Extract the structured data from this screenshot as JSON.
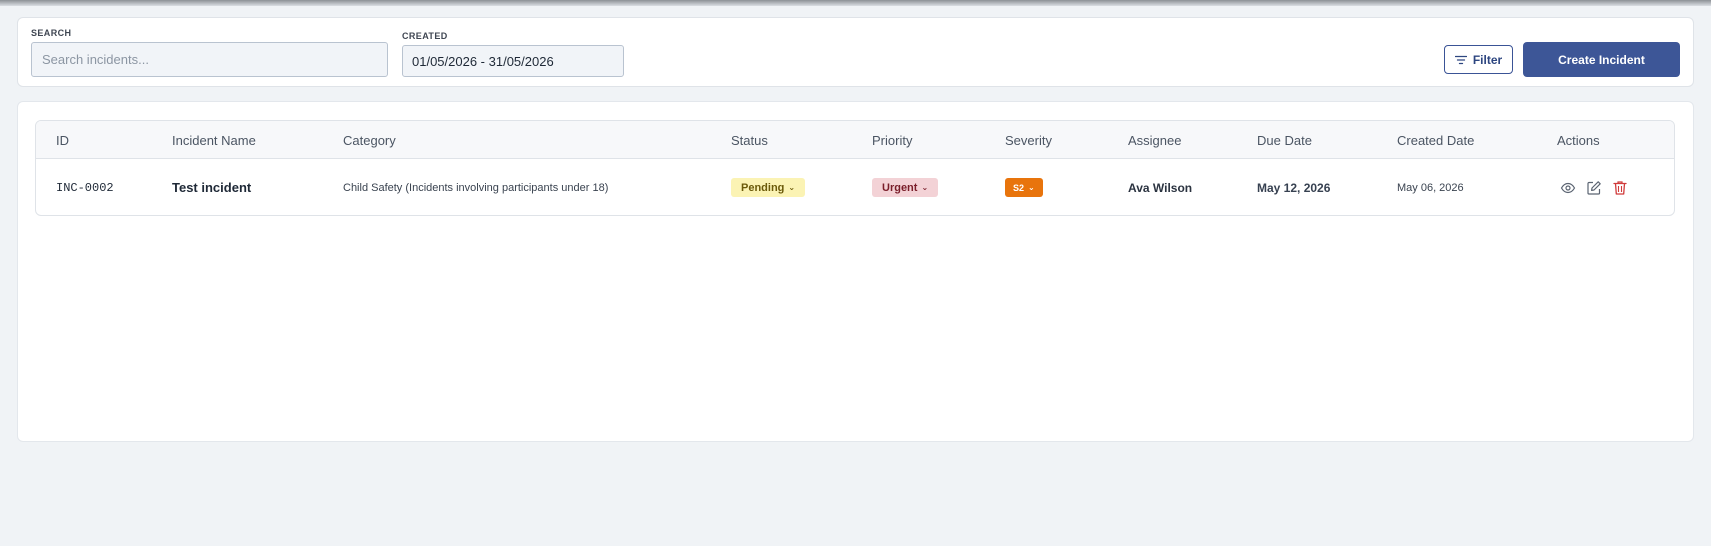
{
  "filters": {
    "search_label": "SEARCH",
    "search_placeholder": "Search incidents...",
    "search_value": "",
    "created_label": "CREATED",
    "created_value": "01/05/2026 - 31/05/2026",
    "filter_button": "Filter",
    "create_button": "Create Incident"
  },
  "table": {
    "columns": [
      "ID",
      "Incident Name",
      "Category",
      "Status",
      "Priority",
      "Severity",
      "Assignee",
      "Due Date",
      "Created Date",
      "Actions"
    ],
    "rows": [
      {
        "id": "INC-0002",
        "name": "Test incident",
        "category": "Child Safety (Incidents involving participants under 18)",
        "status": "Pending",
        "priority": "Urgent",
        "severity": "S2",
        "assignee": "Ava Wilson",
        "due_date": "May 12, 2026",
        "created_date": "May 06, 2026",
        "actions": [
          "eye-icon",
          "edit-icon",
          "trash-icon"
        ]
      }
    ]
  },
  "colors": {
    "primary": "#3d5697",
    "status_pending_bg": "#fbf3b4",
    "status_pending_fg": "#6b5a0a",
    "priority_urgent_bg": "#f3d2d6",
    "priority_urgent_fg": "#7a1e2a",
    "severity_s2_bg": "#e8740c",
    "severity_s2_fg": "#ffffff",
    "delete_icon": "#d03a3a"
  }
}
